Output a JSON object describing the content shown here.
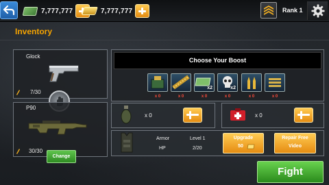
{
  "topbar": {
    "cash_amount": "7,777,777",
    "gold_amount": "7,777,777",
    "rank_label": "Rank 1"
  },
  "inventory": {
    "title": "Inventory",
    "primary": {
      "name": "Glock",
      "ammo": "7/30"
    },
    "secondary": {
      "name": "P90",
      "ammo": "30/30"
    },
    "change_label": "Change"
  },
  "boost": {
    "header": "Choose Your Boost",
    "items": [
      {
        "icon": "ammo-crate-icon",
        "count": "x 0",
        "tag": ""
      },
      {
        "icon": "bullet-belt-icon",
        "count": "x 0",
        "tag": ""
      },
      {
        "icon": "cash-x2-icon",
        "count": "x 0",
        "tag": "x2"
      },
      {
        "icon": "skull-x2-icon",
        "count": "x 0",
        "tag": "x2"
      },
      {
        "icon": "gold-bullets-icon",
        "count": "x 0",
        "tag": ""
      },
      {
        "icon": "ammo-clip-icon",
        "count": "x 0",
        "tag": ""
      }
    ]
  },
  "grenade": {
    "count": "x 0"
  },
  "medkit": {
    "count": "x 0"
  },
  "armor": {
    "armor_label": "Armor",
    "level_label": "Level 1",
    "hp_label": "HP",
    "hp_value": "2/20",
    "upgrade_label": "Upgrade",
    "upgrade_cost": "50",
    "repair_label": "Repair Free",
    "repair_sub": "Video"
  },
  "fight_label": "Fight",
  "colors": {
    "accent_orange": "#f5a300",
    "button_orange": "#e58c12",
    "button_green": "#2e8a22",
    "count_red": "#ff4b3a"
  }
}
